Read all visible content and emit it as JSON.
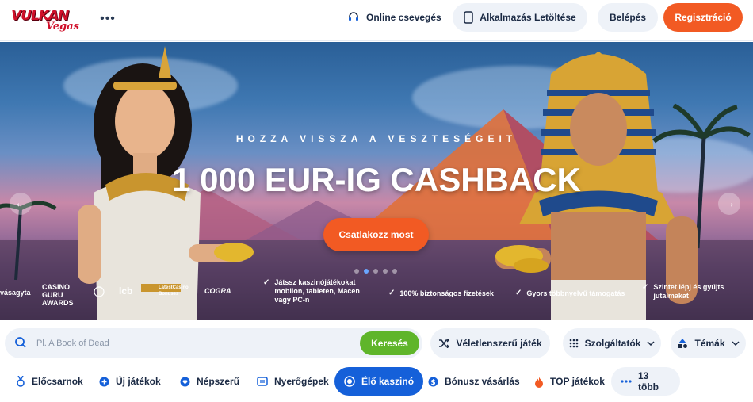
{
  "header": {
    "logo_text_top": "VULKAN",
    "logo_text_bottom": "Vegas",
    "more_icon": "dots-horizontal-icon",
    "chat_label": "Online csevegés",
    "chat_icon": "headset-icon",
    "app_label": "Alkalmazás Letöltése",
    "app_icon": "phone-icon",
    "login_label": "Belépés",
    "register_label": "Regisztráció"
  },
  "banner": {
    "subtitle": "HOZZA VISSZA A VESZTESÉGEIT",
    "title": "1 000 EUR-IG CASHBACK",
    "cta_label": "Csatlakozz most",
    "slide_count": 5,
    "active_slide": 1,
    "awards": [
      "vásagyta",
      "CASINO GURU AWARDS",
      "lcb",
      "LatestCasino Bonuses",
      "COGRA"
    ],
    "features": [
      "Játssz kaszinójátékokat mobilon, tableten, Macen vagy PC-n",
      "100% biztonságos fizetések",
      "Gyors többnyelvű támogatás",
      "Szintet lépj és gyűjts jutalmakat"
    ]
  },
  "search": {
    "placeholder": "Pl. A Book of Dead",
    "button_label": "Keresés"
  },
  "filters": {
    "random_label": "Véletlenszerű játék",
    "providers_label": "Szolgáltatók",
    "themes_label": "Témák"
  },
  "categories": [
    {
      "label": "Előcsarnok",
      "icon": "medal-icon"
    },
    {
      "label": "Új játékok",
      "icon": "plus-circle-icon"
    },
    {
      "label": "Népszerű",
      "icon": "heart-icon"
    },
    {
      "label": "Nyerőgépek",
      "icon": "slot-machine-icon"
    },
    {
      "label": "Élő kaszinó",
      "icon": "live-casino-icon"
    },
    {
      "label": "Bónusz vásárlás",
      "icon": "dollar-coin-icon"
    },
    {
      "label": "TOP játékok",
      "icon": "flame-icon"
    },
    {
      "label": "13 több",
      "icon": "dots-horizontal-icon"
    }
  ],
  "colors": {
    "accent_orange": "#f25a23",
    "search_green": "#5fb52a",
    "active_blue": "#1560d9",
    "text_dark": "#1b2a44"
  }
}
